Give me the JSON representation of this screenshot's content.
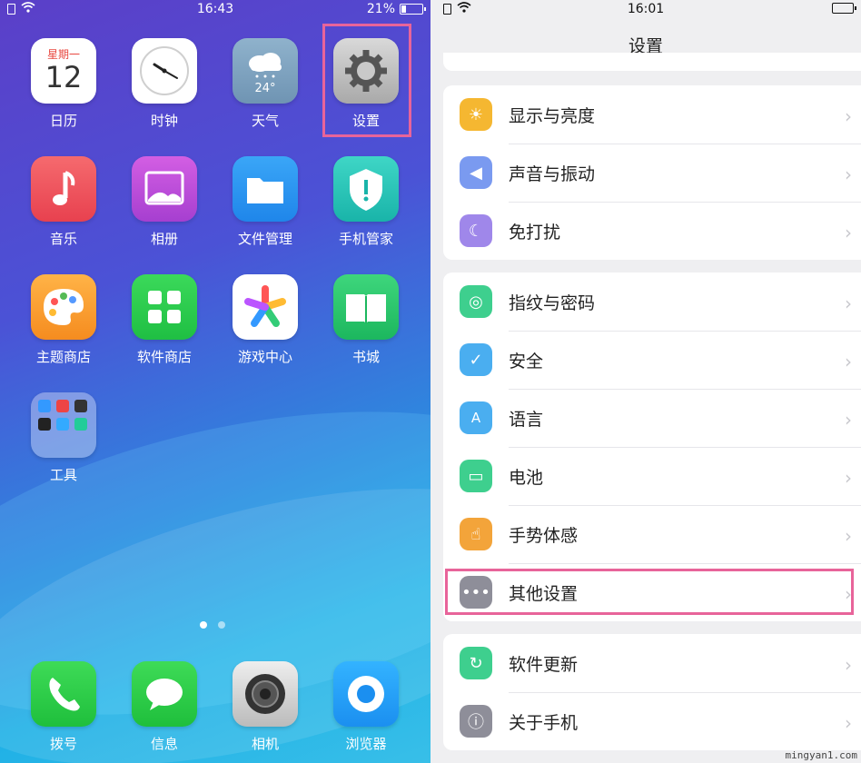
{
  "left_phone": {
    "status": {
      "time": "16:43",
      "battery": "21%"
    },
    "apps": [
      {
        "label": "日历",
        "icon": "calendar-icon",
        "sub": "星期一",
        "date": "12"
      },
      {
        "label": "时钟",
        "icon": "clock-icon"
      },
      {
        "label": "天气",
        "icon": "weather-icon",
        "temp": "24°"
      },
      {
        "label": "设置",
        "icon": "settings-gear-icon"
      },
      {
        "label": "音乐",
        "icon": "music-icon"
      },
      {
        "label": "相册",
        "icon": "gallery-icon"
      },
      {
        "label": "文件管理",
        "icon": "folder-icon"
      },
      {
        "label": "手机管家",
        "icon": "shield-icon"
      },
      {
        "label": "主题商店",
        "icon": "palette-icon"
      },
      {
        "label": "软件商店",
        "icon": "app-store-icon"
      },
      {
        "label": "游戏中心",
        "icon": "game-center-icon"
      },
      {
        "label": "书城",
        "icon": "book-icon"
      },
      {
        "label": "工具",
        "icon": "tools-folder-icon"
      }
    ],
    "dock": [
      {
        "label": "拨号",
        "icon": "phone-icon"
      },
      {
        "label": "信息",
        "icon": "message-icon"
      },
      {
        "label": "相机",
        "icon": "camera-icon"
      },
      {
        "label": "浏览器",
        "icon": "browser-icon"
      }
    ]
  },
  "right_phone": {
    "status": {
      "time": "16:01"
    },
    "title": "设置",
    "group1": [
      {
        "label": "显示与亮度",
        "icon": "brightness-icon",
        "color": "#f5b731"
      },
      {
        "label": "声音与振动",
        "icon": "sound-icon",
        "color": "#7a9af0"
      },
      {
        "label": "免打扰",
        "icon": "moon-icon",
        "color": "#9f87ea"
      }
    ],
    "group2": [
      {
        "label": "指纹与密码",
        "icon": "fingerprint-icon",
        "color": "#3ecf8e"
      },
      {
        "label": "安全",
        "icon": "security-shield-icon",
        "color": "#4aaef0"
      },
      {
        "label": "语言",
        "icon": "language-icon",
        "color": "#4aaef0"
      },
      {
        "label": "电池",
        "icon": "battery-icon",
        "color": "#3ecf8e"
      },
      {
        "label": "手势体感",
        "icon": "gesture-icon",
        "color": "#f3a43a"
      },
      {
        "label": "其他设置",
        "icon": "more-icon",
        "color": "#8e8e99"
      }
    ],
    "group3": [
      {
        "label": "软件更新",
        "icon": "update-icon",
        "color": "#3ecf8e"
      },
      {
        "label": "关于手机",
        "icon": "info-icon",
        "color": "#8e8e99"
      }
    ],
    "chevron": "›"
  },
  "watermark": "mingyan1.com"
}
